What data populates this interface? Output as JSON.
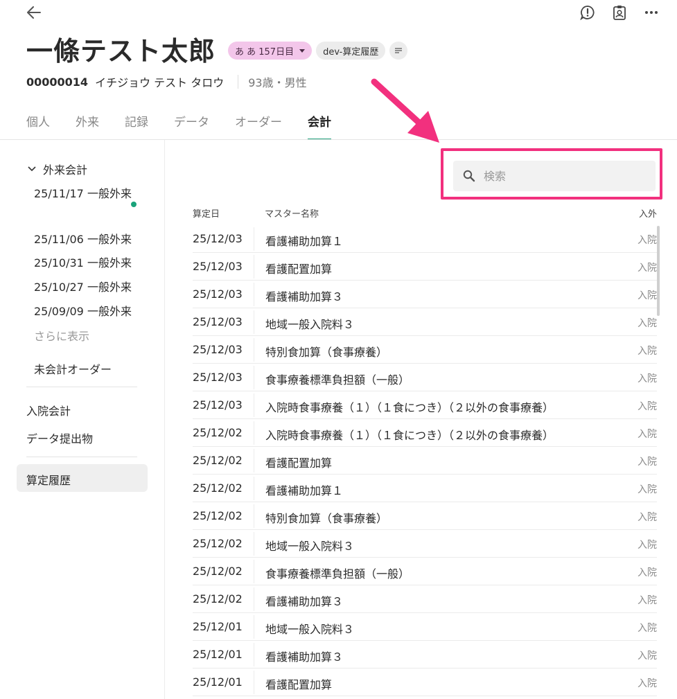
{
  "header": {
    "patient_name": "一條テスト太郎",
    "chip_status": "あ あ 157日目",
    "chip_tag": "dev-算定履歴",
    "patient_id": "00000014",
    "kana": "イチジョウ テスト タロウ",
    "age_sex": "93歳・男性"
  },
  "tabs": [
    "個人",
    "外来",
    "記録",
    "データ",
    "オーダー",
    "会計"
  ],
  "active_tab": "会計",
  "sidebar": {
    "group_label": "外来会計",
    "visits": [
      "25/11/17 一般外来",
      "25/11/06 一般外来",
      "25/10/31 一般外来",
      "25/10/27 一般外来",
      "25/09/09 一般外来"
    ],
    "more_label": "さらに表示",
    "unbilled_label": "未会計オーダー",
    "inpatient_label": "入院会計",
    "data_submission_label": "データ提出物",
    "history_label": "算定履歴"
  },
  "search": {
    "placeholder": "検索"
  },
  "table": {
    "headers": {
      "date": "算定日",
      "name": "マスター名称",
      "type": "入外"
    },
    "rows": [
      {
        "date": "25/12/03",
        "name": "看護補助加算１",
        "type": "入院"
      },
      {
        "date": "25/12/03",
        "name": "看護配置加算",
        "type": "入院"
      },
      {
        "date": "25/12/03",
        "name": "看護補助加算３",
        "type": "入院"
      },
      {
        "date": "25/12/03",
        "name": "地域一般入院料３",
        "type": "入院"
      },
      {
        "date": "25/12/03",
        "name": "特別食加算（食事療養）",
        "type": "入院"
      },
      {
        "date": "25/12/03",
        "name": "食事療養標準負担額（一般）",
        "type": "入院"
      },
      {
        "date": "25/12/03",
        "name": "入院時食事療養（１）（１食につき）（２以外の食事療養）",
        "type": "入院"
      },
      {
        "date": "25/12/02",
        "name": "入院時食事療養（１）（１食につき）（２以外の食事療養）",
        "type": "入院"
      },
      {
        "date": "25/12/02",
        "name": "看護配置加算",
        "type": "入院"
      },
      {
        "date": "25/12/02",
        "name": "看護補助加算１",
        "type": "入院"
      },
      {
        "date": "25/12/02",
        "name": "特別食加算（食事療養）",
        "type": "入院"
      },
      {
        "date": "25/12/02",
        "name": "地域一般入院料３",
        "type": "入院"
      },
      {
        "date": "25/12/02",
        "name": "食事療養標準負担額（一般）",
        "type": "入院"
      },
      {
        "date": "25/12/02",
        "name": "看護補助加算３",
        "type": "入院"
      },
      {
        "date": "25/12/01",
        "name": "地域一般入院料３",
        "type": "入院"
      },
      {
        "date": "25/12/01",
        "name": "看護補助加算３",
        "type": "入院"
      },
      {
        "date": "25/12/01",
        "name": "看護配置加算",
        "type": "入院"
      }
    ]
  },
  "colors": {
    "accent": "#1f9e7a",
    "highlight": "#f2307e",
    "status_chip": "#f3c6ea"
  }
}
